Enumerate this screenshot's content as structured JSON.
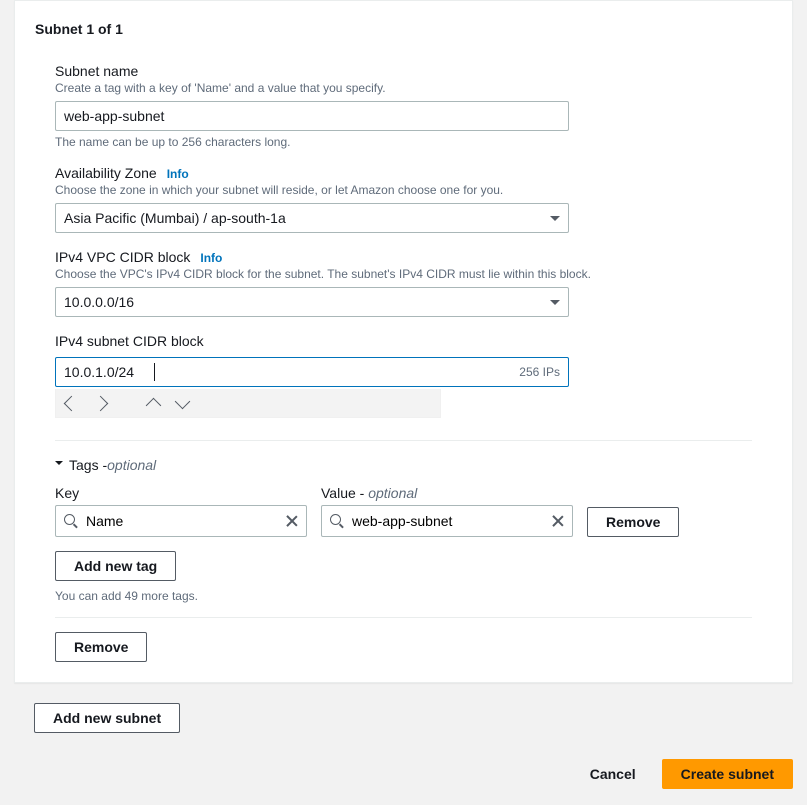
{
  "section_title": "Subnet 1 of 1",
  "subnet_name": {
    "label": "Subnet name",
    "hint": "Create a tag with a key of 'Name' and a value that you specify.",
    "value": "web-app-subnet",
    "after_hint": "The name can be up to 256 characters long."
  },
  "availability_zone": {
    "label": "Availability Zone",
    "info": "Info",
    "hint": "Choose the zone in which your subnet will reside, or let Amazon choose one for you.",
    "value": "Asia Pacific (Mumbai) / ap-south-1a"
  },
  "vpc_cidr": {
    "label": "IPv4 VPC CIDR block",
    "info": "Info",
    "hint": "Choose the VPC's IPv4 CIDR block for the subnet. The subnet's IPv4 CIDR must lie within this block.",
    "value": "10.0.0.0/16"
  },
  "subnet_cidr": {
    "label": "IPv4 subnet CIDR block",
    "value": "10.0.1.0/24",
    "ip_count": "256 IPs"
  },
  "tags": {
    "header": "Tags - ",
    "header_opt": "optional",
    "key_label": "Key",
    "value_label": "Value - ",
    "value_opt": "optional",
    "key": "Name",
    "value": "web-app-subnet",
    "remove_label": "Remove",
    "add_label": "Add new tag",
    "limit_text": "You can add 49 more tags."
  },
  "inner_remove_label": "Remove",
  "add_subnet_label": "Add new subnet",
  "footer": {
    "cancel": "Cancel",
    "submit": "Create subnet"
  }
}
